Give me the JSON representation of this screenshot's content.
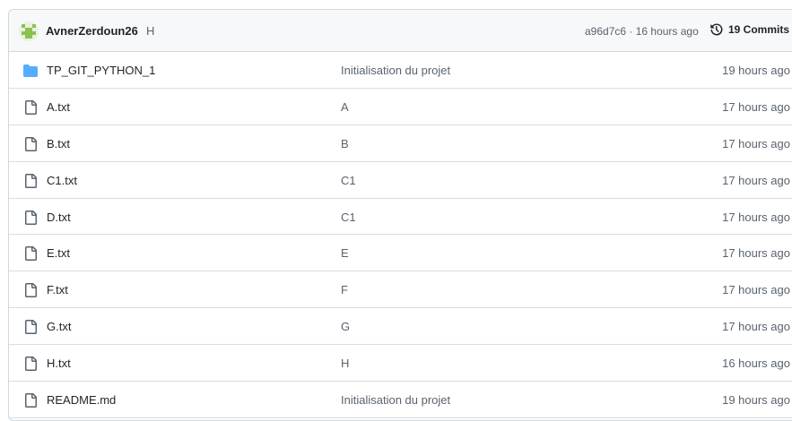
{
  "header": {
    "author": "AvnerZerdoun26",
    "commit_message": "H",
    "commit_meta": "a96d7c6 · 16 hours ago",
    "commits_label": "19 Commits"
  },
  "files": [
    {
      "name": "TP_GIT_PYTHON_1",
      "type": "folder",
      "message": "Initialisation du projet",
      "date": "19 hours ago"
    },
    {
      "name": "A.txt",
      "type": "file",
      "message": "A",
      "date": "17 hours ago"
    },
    {
      "name": "B.txt",
      "type": "file",
      "message": "B",
      "date": "17 hours ago"
    },
    {
      "name": "C1.txt",
      "type": "file",
      "message": "C1",
      "date": "17 hours ago"
    },
    {
      "name": "D.txt",
      "type": "file",
      "message": "C1",
      "date": "17 hours ago"
    },
    {
      "name": "E.txt",
      "type": "file",
      "message": "E",
      "date": "17 hours ago"
    },
    {
      "name": "F.txt",
      "type": "file",
      "message": "F",
      "date": "17 hours ago"
    },
    {
      "name": "G.txt",
      "type": "file",
      "message": "G",
      "date": "17 hours ago"
    },
    {
      "name": "H.txt",
      "type": "file",
      "message": "H",
      "date": "16 hours ago"
    },
    {
      "name": "README.md",
      "type": "file",
      "message": "Initialisation du projet",
      "date": "19 hours ago"
    }
  ],
  "icons": {
    "folder": "folder-icon",
    "file": "file-icon",
    "history": "history-icon",
    "avatar": "avatar"
  },
  "colors": {
    "folder": "#54aeff",
    "header_bg": "#f6f8fa",
    "border": "#d0d7de",
    "muted_text": "#59636e"
  }
}
